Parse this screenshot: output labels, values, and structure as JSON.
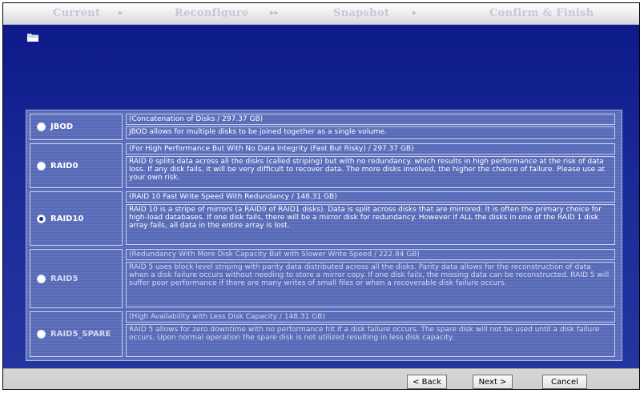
{
  "steps": [
    {
      "label": "Current"
    },
    {
      "label": "Reconfigure"
    },
    {
      "label": "Snapshot"
    },
    {
      "label": "Confirm & Finish"
    }
  ],
  "options": [
    {
      "label": "JBOD",
      "selected": false,
      "heading": "(Concatenation of Disks / 297.37 GB)",
      "description": "JBOD allows for multiple disks to be joined together as a single volume."
    },
    {
      "label": "RAID0",
      "selected": false,
      "heading": "(For High Performance But With No Data Integrity (Fast But Risky) / 297.37 GB)",
      "description": "RAID 0 splits data across all the disks (called striping) but with no redundancy. which results in high performance at the risk of data loss. If any disk fails, it will be very difficult to recover data. The more disks involved, the higher the chance of failure. Please use at your own risk."
    },
    {
      "label": "RAID10",
      "selected": true,
      "heading": "(RAID 10 Fast Write Speed With Redundancy / 148.31 GB)",
      "description": "RAID 10 is a stripe of mirrors (a RAID0 of RAID1 disks). Data is split across disks that are mirrored. It is often the primary choice for high-load databases. If one disk fails, there will be a mirror disk for redundancy. However if ALL the disks in one of the RAID 1 disk array fails, all data in the entire array is lost."
    },
    {
      "label": "RAID5",
      "selected": false,
      "heading": "(Redundancy With More Disk Capacity But with Slower Write Speed / 222.84 GB)",
      "description": "RAID 5 uses block level striping with parity data distributed across all the disks. Parity data allows for the reconstruction of data when a disk failure occurs without needing to store a mirror copy. If one disk fails, the missing data can be reconstructed. RAID 5 will suffer poor performance if there are many writes of small files or when a recoverable disk failure occurs."
    },
    {
      "label": "RAID5_SPARE",
      "selected": false,
      "heading": "(High Availability with Less Disk Capacity / 148.31 GB)",
      "description": "RAID 5 allows for zero downtime with no performance hit if a disk failure occurs. The spare disk will not be used until a disk failure occurs. Upon normal operation the spare disk is not utilized resulting in less disk capacity."
    }
  ],
  "buttons": {
    "back": "< Back",
    "next": "Next >",
    "cancel": "Cancel"
  },
  "colors": {
    "background": "#1c2d9a",
    "panel": "#5e70bb",
    "bottom_bar": "#d0d0d0"
  }
}
